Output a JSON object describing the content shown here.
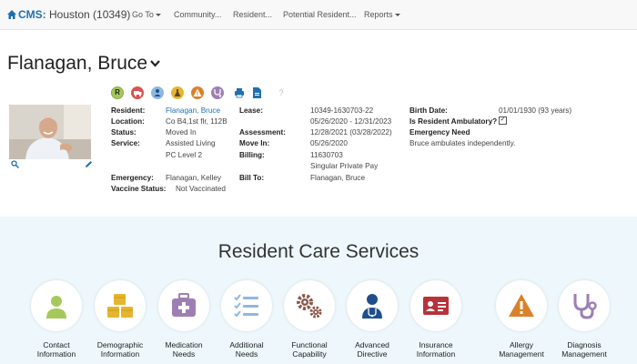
{
  "nav": {
    "brand_prefix": "CMS:",
    "brand_site": " Houston (10349)",
    "items": [
      "Go To",
      "Community...",
      "Resident...",
      "Potential Resident...",
      "Reports"
    ]
  },
  "resident": {
    "name": "Flanagan, Bruce",
    "quick_icons": [
      "R",
      "",
      "",
      "",
      "",
      "",
      "",
      "",
      "?"
    ],
    "col1": {
      "resident_label": "Resident:",
      "resident_value": "Flanagan, Bruce",
      "location_label": "Location:",
      "location_value": "Co B4,1st flr, 112B",
      "status_label": "Status:",
      "status_value": "Moved In",
      "service_label": "Service:",
      "service_value": "Assisted Living",
      "service_value2": "PC Level 2",
      "emergency_label": "Emergency:",
      "emergency_value": "Flanagan, Kelley",
      "vaccine_label": "Vaccine Status:",
      "vaccine_value": "Not Vaccinated"
    },
    "col2": {
      "lease_label": "Lease:",
      "lease_value": "10349-1630703-22",
      "lease_dates": "05/26/2020 - 12/31/2023",
      "assessment_label": "Assessment:",
      "assessment_value": "12/28/2021 (03/28/2022)",
      "movein_label": "Move In:",
      "movein_value": "05/26/2020",
      "billing_label": "Billing:",
      "billing_value": "11630703",
      "billing_value2": "Singular Private Pay",
      "billto_label": "Bill To:",
      "billto_value": "Flanagan, Bruce"
    },
    "col3": {
      "birth_label": "Birth Date:",
      "birth_value": "01/01/1930 (93 years)",
      "ambulatory_label": "Is Resident Ambulatory?",
      "ambulatory_check": "✓",
      "emergency_need_label": "Emergency Need",
      "emergency_need_value": "Bruce ambulates independently."
    }
  },
  "services": {
    "title": "Resident Care Services",
    "items": [
      {
        "line1": "Contact",
        "line2": "Information"
      },
      {
        "line1": "Demographic",
        "line2": "Information"
      },
      {
        "line1": "Medication",
        "line2": "Needs"
      },
      {
        "line1": "Additional",
        "line2": "Needs"
      },
      {
        "line1": "Functional",
        "line2": "Capability"
      },
      {
        "line1": "Advanced",
        "line2": "Directive"
      },
      {
        "line1": "Insurance",
        "line2": "Information"
      },
      {
        "line1": "Allergy",
        "line2": "Management"
      },
      {
        "line1": "Diagnosis",
        "line2": "Management"
      }
    ]
  },
  "colors": {
    "brand_blue": "#1f6fb2",
    "green": "#a4c95a",
    "gold": "#e6b52f",
    "purple": "#9e7fb3",
    "light_blue": "#8fb8de",
    "brown": "#8a5a4a",
    "navy": "#1f4e8c",
    "red": "#b8323a",
    "orange": "#d9822b",
    "section_bg": "#eef8fc"
  }
}
